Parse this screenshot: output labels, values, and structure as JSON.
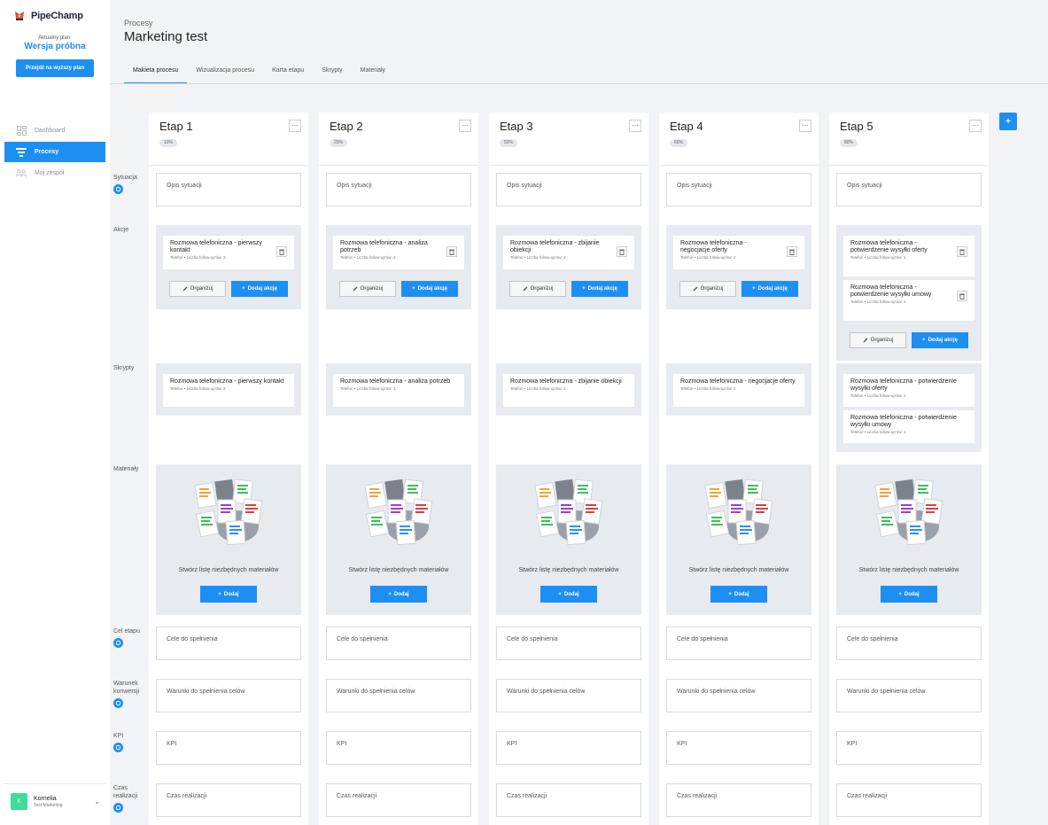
{
  "app": {
    "name": "PipeChamp"
  },
  "plan": {
    "label": "Aktualny plan:",
    "name": "Wersja próbna",
    "upgrade_label": "Przejdź na wyższy plan"
  },
  "nav": {
    "items": [
      {
        "label": "Dashboard",
        "icon": "dashboard-icon"
      },
      {
        "label": "Procesy",
        "icon": "funnel-icon",
        "active": true
      },
      {
        "label": "Mój zespół",
        "icon": "team-icon"
      }
    ]
  },
  "user": {
    "initial": "K",
    "name": "Kornelia",
    "team": "Test Marketing"
  },
  "header": {
    "breadcrumb": "Procesy",
    "title": "Marketing test"
  },
  "tabs": [
    "Makieta procesu",
    "Wizualizacja procesu",
    "Karta etapu",
    "Skrypty",
    "Materiały"
  ],
  "add_stage_label": "+",
  "rows": {
    "situation": "Sytuacja",
    "actions": "Akcje",
    "scripts": "Skrypty",
    "materials": "Materiały",
    "goal": "Cel etapu",
    "conversion": "Warunek konwersji",
    "kpi": "KPI",
    "time": "Czas realizacji"
  },
  "labels": {
    "menu": "···",
    "situation_placeholder": "Opis sytuacji",
    "organize": "Organizuj",
    "add_action": "Dodaj akcję",
    "materials_text": "Stwórz listę niezbędnych materiałów",
    "materials_add": "Dodaj",
    "goal_placeholder": "Cele do spełnienia",
    "conversion_placeholder": "Warunki do spełnienia celów",
    "kpi_placeholder": "KPI",
    "time_placeholder": "Czas realizacji"
  },
  "stages": [
    {
      "title": "Etap 1",
      "pct": "10%",
      "actions": [
        {
          "title": "Rozmowa telefoniczna - pierwszy kontakt",
          "meta": "Telefon • Liczba follow-up'ów: 3"
        }
      ],
      "scripts": [
        {
          "title": "Rozmowa telefoniczna - pierwszy kontakt",
          "meta": "Telefon • Liczba follow-up'ów: 3"
        }
      ]
    },
    {
      "title": "Etap 2",
      "pct": "20%",
      "actions": [
        {
          "title": "Rozmowa telefoniczna - analiza potrzeb",
          "meta": "Telefon • Liczba follow-up'ów: 3"
        }
      ],
      "scripts": [
        {
          "title": "Rozmowa telefoniczna - analiza potrzeb",
          "meta": "Telefon • Liczba follow-up'ów: 3"
        }
      ]
    },
    {
      "title": "Etap 3",
      "pct": "50%",
      "actions": [
        {
          "title": "Rozmowa telefoniczna - zbijanie obiekcji",
          "meta": "Telefon • Liczba follow-up'ów: 2"
        }
      ],
      "scripts": [
        {
          "title": "Rozmowa telefoniczna - zbijanie obiekcji",
          "meta": "Telefon • Liczba follow-up'ów: 2"
        }
      ]
    },
    {
      "title": "Etap 4",
      "pct": "65%",
      "actions": [
        {
          "title": "Rozmowa telefoniczna - negocjacje oferty",
          "meta": "Telefon • Liczba follow-up'ów: 2"
        }
      ],
      "scripts": [
        {
          "title": "Rozmowa telefoniczna - negocjacje oferty",
          "meta": "Telefon • Liczba follow-up'ów: 2"
        }
      ]
    },
    {
      "title": "Etap 5",
      "pct": "80%",
      "actions": [
        {
          "title": "Rozmowa telefoniczna - potwierdzenie wysyłki oferty",
          "meta": "Telefon • Liczba follow-up'ów: 1"
        },
        {
          "title": "Rozmowa telefoniczna - potwierdzenie wysyłki umowy",
          "meta": "Telefon • Liczba follow-up'ów: 1"
        }
      ],
      "scripts": [
        {
          "title": "Rozmowa telefoniczna - potwierdzenie wysyłki oferty",
          "meta": "Telefon • Liczba follow-up'ów: 1"
        },
        {
          "title": "Rozmowa telefoniczna - potwierdzenie wysyłki umowy",
          "meta": "Telefon • Liczba follow-up'ów: 1"
        }
      ]
    }
  ],
  "colors": {
    "accent": "#1d8ff2",
    "avatar": "#3ddc97"
  }
}
